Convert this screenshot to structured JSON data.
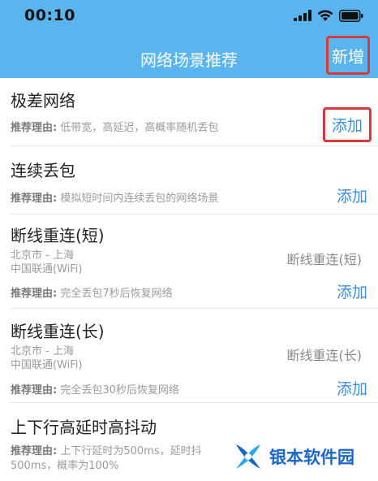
{
  "status": {
    "time": "00:10"
  },
  "nav": {
    "title": "网络场景推荐",
    "add_label": "新增"
  },
  "reason_label": "推荐理由:",
  "items": [
    {
      "title": "极差网络",
      "reason": "低带宽，高延迟，高概率随机丢包",
      "add_label": "添加"
    },
    {
      "title": "连续丢包",
      "reason": "模拟短时间内连续丢包的网络场景",
      "add_label": "添加"
    },
    {
      "title": "断线重连(短)",
      "route": "北京市 - 上海",
      "carrier": "中国联通(WiFi)",
      "mode": "断线重连(短)",
      "reason": "完全丢包7秒后恢复网络",
      "add_label": "添加"
    },
    {
      "title": "断线重连(长)",
      "route": "北京市 - 上海",
      "carrier": "中国联通(WiFi)",
      "mode": "断线重连(长)",
      "reason": "完全丢包30秒后恢复网络",
      "add_label": "添加"
    },
    {
      "title": "上下行高延时高抖动",
      "reason_line1": "上下行延时为500ms，延时抖",
      "reason_line2": "500ms，概率为100%"
    }
  ],
  "watermark": {
    "text": "银本软件园"
  }
}
